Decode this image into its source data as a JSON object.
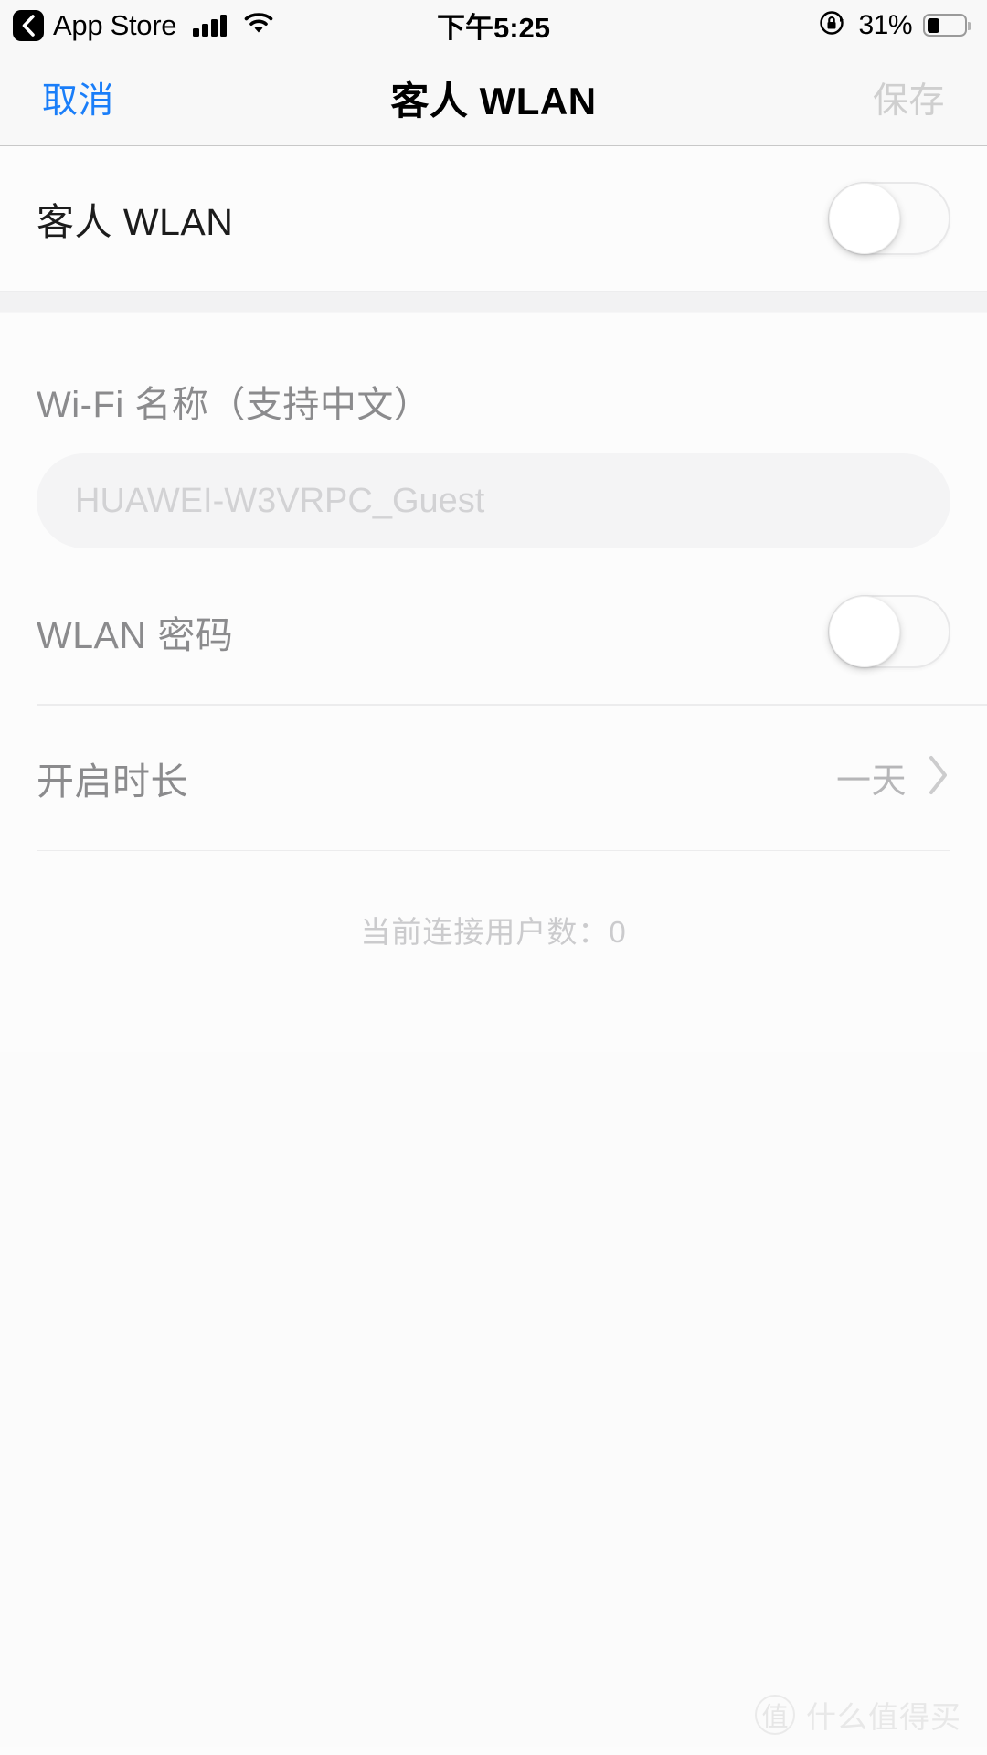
{
  "status_bar": {
    "back_icon": "chevron-left-icon",
    "app_name": "App Store",
    "signal_icon": "cellular-signal-icon",
    "wifi_icon": "wifi-icon",
    "time": "下午5:25",
    "rotation_lock_icon": "rotation-lock-icon",
    "battery_percent": "31%",
    "battery_level": 31,
    "battery_icon": "battery-icon"
  },
  "nav_bar": {
    "cancel_label": "取消",
    "title": "客人 WLAN",
    "save_label": "保存",
    "cancel_color": "#1a7ef9",
    "save_color": "#cfcfcf"
  },
  "main": {
    "guest_wlan_row": {
      "label": "客人 WLAN",
      "toggle_state": "off"
    },
    "wifi_name": {
      "label": "Wi-Fi 名称（支持中文）",
      "value": "",
      "placeholder": "HUAWEI-W3VRPC_Guest"
    },
    "wlan_password_row": {
      "label": "WLAN 密码",
      "toggle_state": "off"
    },
    "duration_row": {
      "label": "开启时长",
      "value": "一天",
      "chevron_icon": "chevron-right-icon"
    },
    "footer_note": "当前连接用户数：0"
  },
  "watermark": {
    "badge": "值",
    "text": "什么值得买"
  }
}
